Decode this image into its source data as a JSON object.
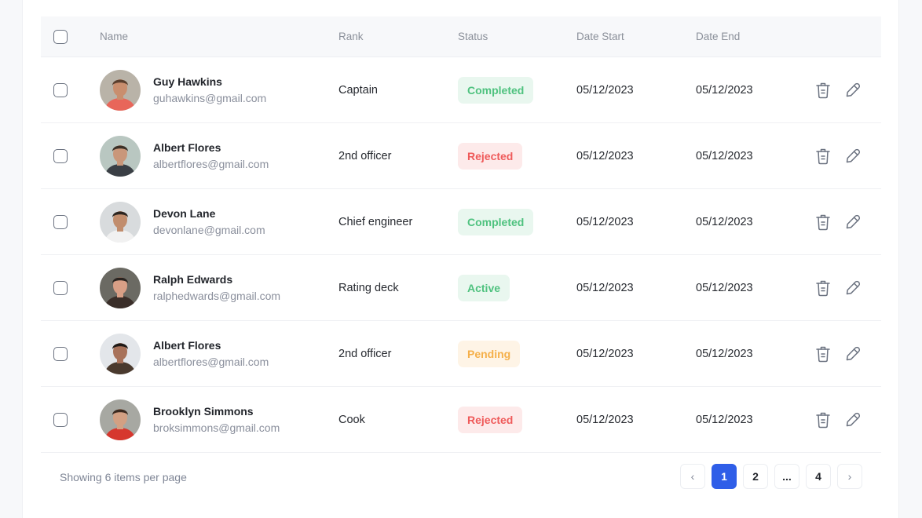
{
  "table": {
    "headers": {
      "name": "Name",
      "rank": "Rank",
      "status": "Status",
      "date_start": "Date Start",
      "date_end": "Date End"
    },
    "rows": [
      {
        "name": "Guy Hawkins",
        "email": "guhawkins@gmail.com",
        "rank": "Captain",
        "status": "Completed",
        "date_start": "05/12/2023",
        "date_end": "05/12/2023"
      },
      {
        "name": "Albert Flores",
        "email": "albertflores@gmail.com",
        "rank": "2nd officer",
        "status": "Rejected",
        "date_start": "05/12/2023",
        "date_end": "05/12/2023"
      },
      {
        "name": "Devon Lane",
        "email": "devonlane@gmail.com",
        "rank": "Chief engineer",
        "status": "Completed",
        "date_start": "05/12/2023",
        "date_end": "05/12/2023"
      },
      {
        "name": "Ralph Edwards",
        "email": "ralphedwards@gmail.com",
        "rank": "Rating deck",
        "status": "Active",
        "date_start": "05/12/2023",
        "date_end": "05/12/2023"
      },
      {
        "name": "Albert Flores",
        "email": "albertflores@gmail.com",
        "rank": "2nd officer",
        "status": "Pending",
        "date_start": "05/12/2023",
        "date_end": "05/12/2023"
      },
      {
        "name": "Brooklyn Simmons",
        "email": "broksimmons@gmail.com",
        "rank": "Cook",
        "status": "Rejected",
        "date_start": "05/12/2023",
        "date_end": "05/12/2023"
      }
    ]
  },
  "status_colors": {
    "Completed": {
      "text": "#4fc27f",
      "bg": "#e9f7ef"
    },
    "Active": {
      "text": "#4fc27f",
      "bg": "#e9f7ef"
    },
    "Rejected": {
      "text": "#ef5a5a",
      "bg": "#fdeaea"
    },
    "Pending": {
      "text": "#f5b04a",
      "bg": "#fef4e6"
    }
  },
  "avatar_colors": [
    {
      "bg": "#b9b3a8",
      "skin": "#c98e6e",
      "hair": "#5a3f2e",
      "shirt": "#e8665a"
    },
    {
      "bg": "#b9c7c1",
      "skin": "#c9977a",
      "hair": "#3b3027",
      "shirt": "#3a3f45"
    },
    {
      "bg": "#d8dbdd",
      "skin": "#c18d6d",
      "hair": "#2c2520",
      "shirt": "#f1f1f1"
    },
    {
      "bg": "#6b6a63",
      "skin": "#d89f86",
      "hair": "#2a2420",
      "shirt": "#3a2e29"
    },
    {
      "bg": "#e3e6ea",
      "skin": "#a8725a",
      "hair": "#1f1a17",
      "shirt": "#4a3a2e"
    },
    {
      "bg": "#a7a8a2",
      "skin": "#d3a083",
      "hair": "#3b2a20",
      "shirt": "#d6372e"
    }
  ],
  "actions": {
    "delete_icon": "trash-icon",
    "edit_icon": "pencil-icon"
  },
  "footer": {
    "showing_text": "Showing 6 items per page",
    "pagination": {
      "prev": "‹",
      "pages": [
        "1",
        "2",
        "...",
        "4"
      ],
      "current": "1",
      "next": "›"
    }
  },
  "accent_color": "#2f5ee8"
}
